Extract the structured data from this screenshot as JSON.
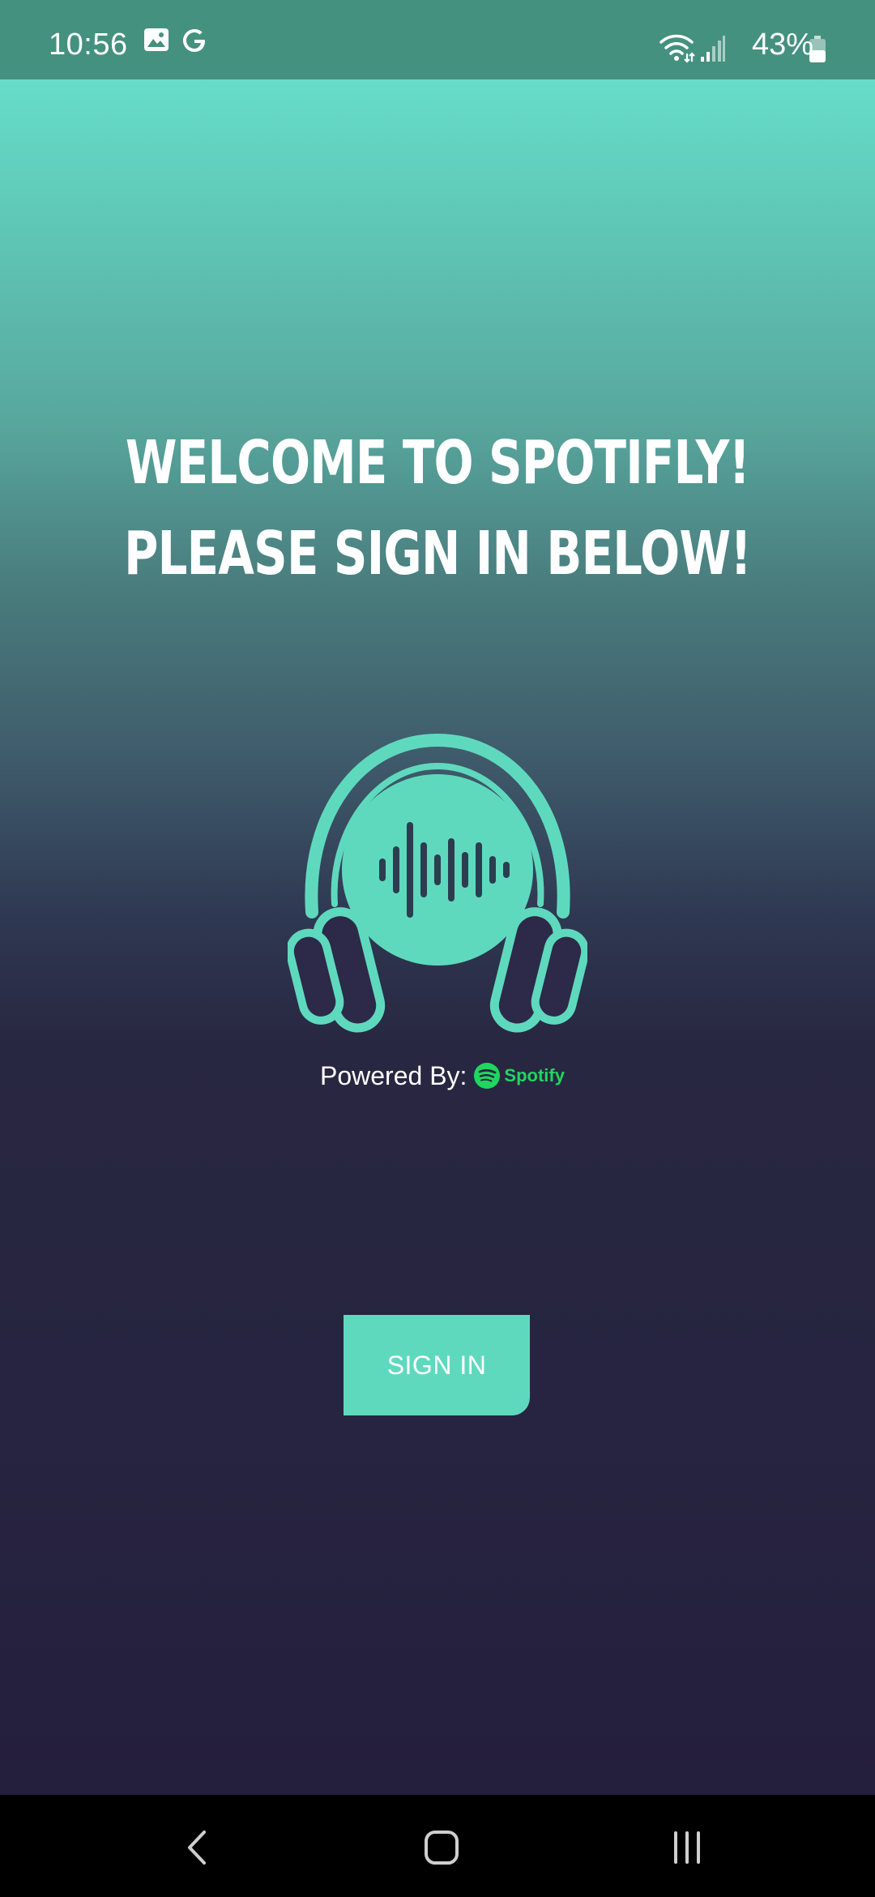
{
  "status_bar": {
    "time": "10:56",
    "battery": "43%",
    "icons": [
      "image-icon",
      "google-icon",
      "wifi-icon",
      "signal-icon",
      "battery-icon"
    ]
  },
  "headline": {
    "line1": "WELCOME TO SPOTIFLY!",
    "line2": "PLEASE SIGN IN BELOW!"
  },
  "logo": {
    "icon": "headphones-soundwave-icon"
  },
  "powered_by": {
    "label": "Powered By:",
    "brand": "Spotify"
  },
  "actions": {
    "sign_in": "SIGN IN"
  },
  "nav_bar": {
    "items": [
      "back-icon",
      "home-icon",
      "recents-icon"
    ]
  },
  "colors": {
    "accent": "#5fd9be",
    "status_bar": "#45917f",
    "spotify_green": "#1ed760",
    "background_dark": "#262440"
  }
}
